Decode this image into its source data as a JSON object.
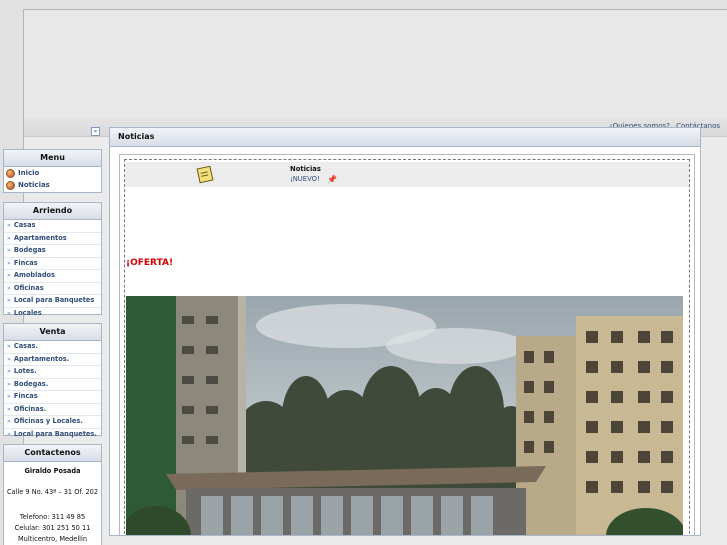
{
  "toplinks": {
    "about": "¿Quienes somos?",
    "contact": "Contáctanos"
  },
  "collapse_glyph": "«",
  "menu": {
    "title": "Menu",
    "items": [
      {
        "label": "Inicio",
        "icon": "home-icon"
      },
      {
        "label": "Noticias",
        "icon": "news-icon"
      }
    ]
  },
  "arriendo": {
    "title": "Arriendo",
    "items": [
      "Casas",
      "Apartamentos",
      "Bodegas",
      "Fincas",
      "Amoblados",
      "Oficinas",
      "Local para Banquetes",
      "Locales"
    ]
  },
  "venta": {
    "title": "Venta",
    "items": [
      "Casas.",
      "Apartamentos.",
      "Lotes.",
      "Bodegas.",
      "Fincas",
      "Oficinas.",
      "Oficinas y Locales.",
      "Local para Banquetes."
    ]
  },
  "contactenos": {
    "title": "Contactenos",
    "name": "Giraldo Posada",
    "address": "Calle 9 No. 43ª – 31 Of. 202",
    "phone": "Telefono: 311 49 85",
    "cell": "Celular: 301 251 50 11",
    "extra": "Multicentro, Medellín"
  },
  "main": {
    "title": "Noticias",
    "news_label": "Noticias",
    "nuevo": "¡NUEVO!",
    "oferta": "¡OFERTA!"
  },
  "colors": {
    "link": "#2f4e79",
    "offer": "#d40000",
    "border": "#a9b6c8"
  }
}
